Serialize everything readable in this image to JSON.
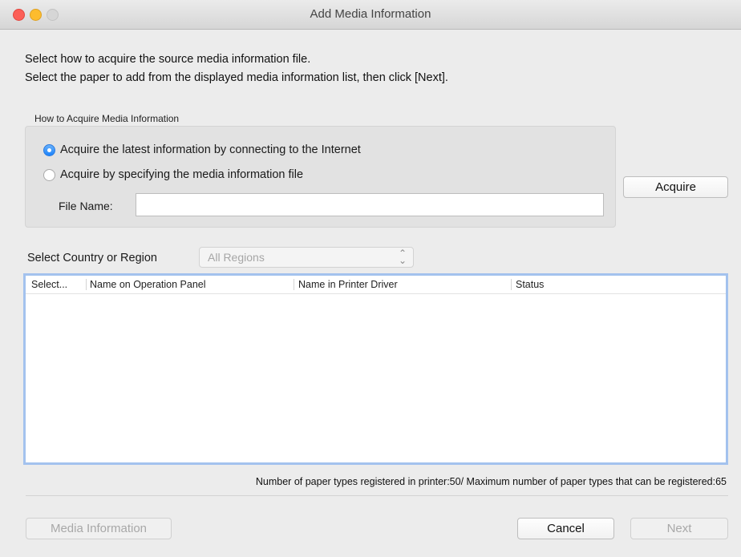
{
  "window": {
    "title": "Add Media Information"
  },
  "instructions": {
    "line1": "Select how to acquire the source media information file.",
    "line2": "Select the paper to add from the displayed media information list, then click [Next]."
  },
  "acquire_group": {
    "label": "How to Acquire Media Information",
    "options": [
      {
        "label": "Acquire the latest information by connecting to the Internet",
        "selected": true
      },
      {
        "label": "Acquire by specifying the media information file",
        "selected": false
      }
    ],
    "file_name_label": "File Name:",
    "file_name_value": ""
  },
  "acquire_button": "Acquire",
  "region": {
    "label": "Select Country or Region",
    "selected": "All Regions"
  },
  "table": {
    "columns": [
      "Select...",
      "Name on Operation Panel",
      "Name in Printer Driver",
      "Status"
    ],
    "rows": []
  },
  "paper_count_text": "Number of paper types registered in printer:50/ Maximum number of paper types that can be registered:65",
  "footer": {
    "media_information": "Media Information",
    "cancel": "Cancel",
    "next": "Next"
  },
  "colors": {
    "accent": "#1a82fb",
    "focus_ring": "#a3c2ee"
  }
}
